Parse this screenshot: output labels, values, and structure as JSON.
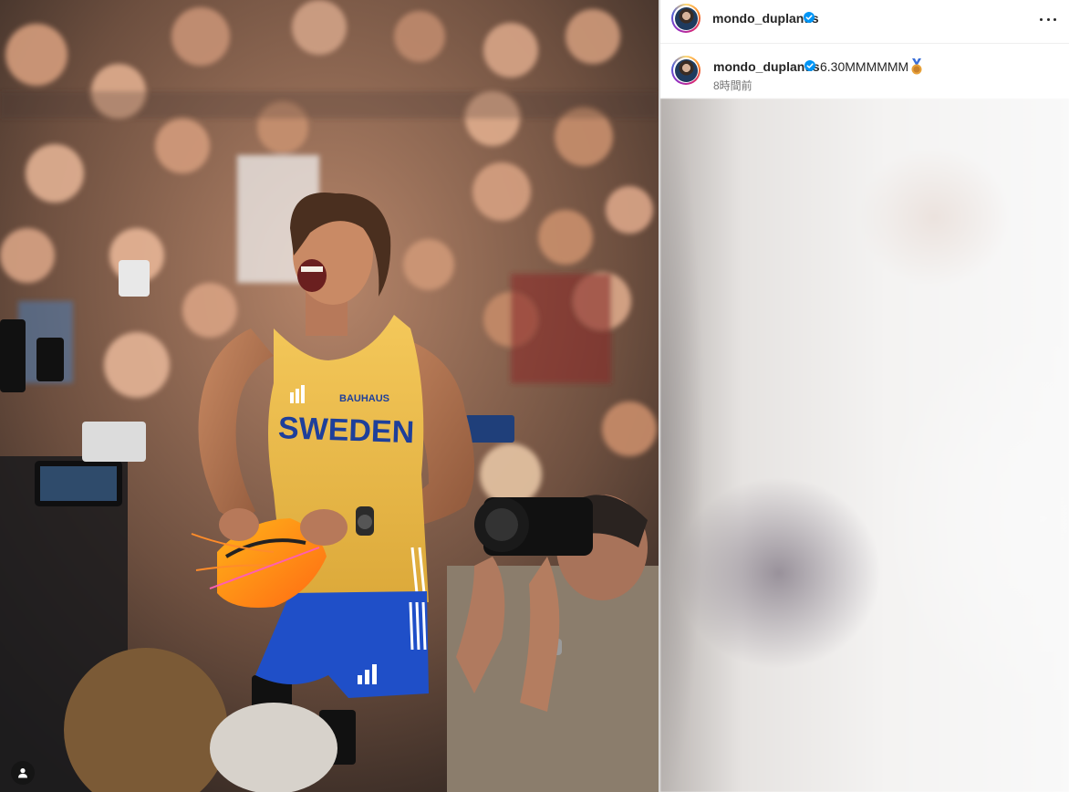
{
  "post": {
    "username": "mondo_duplantis",
    "caption": "6.30MMMMMM",
    "time_ago": "8時間前"
  },
  "photo": {
    "jersey_text": "SWEDEN",
    "sponsor_text": "BAUHAUS"
  },
  "icons": {
    "more": "more-options-icon",
    "verified": "verified-badge-icon",
    "medal": "medal-icon",
    "tag_user": "user-tag-icon"
  },
  "colors": {
    "verified_blue": "#0095f6",
    "jersey_yellow": "#f2c14e",
    "shorts_blue": "#1f4fc8",
    "username_text": "#262626",
    "secondary_text": "#737373"
  }
}
